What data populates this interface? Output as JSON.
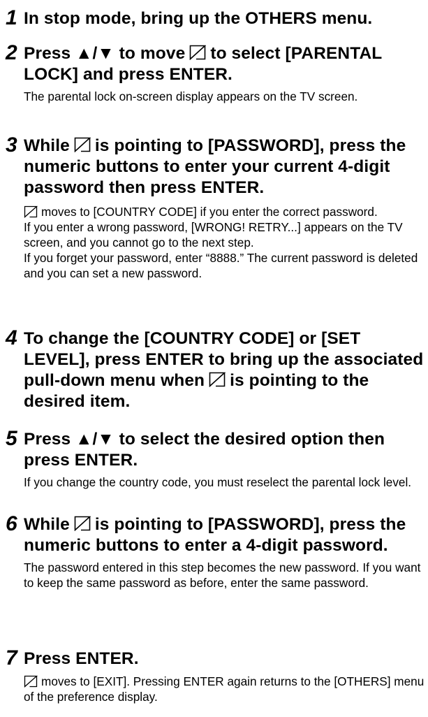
{
  "steps": [
    {
      "number": "1",
      "heading_parts": [
        "In stop mode, bring up the OTHERS menu."
      ],
      "body": []
    },
    {
      "number": "2",
      "heading_parts": [
        "Press ▲/▼ to move",
        "to select [PARENTAL LOCK] and press ENTER."
      ],
      "body": [
        "The parental lock on-screen display appears on the TV screen."
      ]
    },
    {
      "number": "3",
      "heading_parts": [
        "While",
        "is pointing to [PASSWORD], press the numeric buttons to enter your current 4-digit password then press ENTER."
      ],
      "body_cursor_line": "moves to [COUNTRY CODE] if you enter the correct password.",
      "body": [
        "If you enter a wrong password, [WRONG! RETRY...] appears on the TV screen, and you cannot go to the next step.",
        "If you forget your password, enter “8888.” The current password is deleted and you can set a new password."
      ]
    },
    {
      "number": "4",
      "heading_parts": [
        "To change the [COUNTRY CODE] or [SET LEVEL], press ENTER to bring up the associated pull-down menu when",
        "is pointing to the desired item."
      ],
      "body": []
    },
    {
      "number": "5",
      "heading_parts": [
        "Press ▲/▼ to select the desired option then press ENTER."
      ],
      "body": [
        "If you change the country code, you must reselect the parental lock level."
      ]
    },
    {
      "number": "6",
      "heading_parts": [
        "While",
        "is pointing to [PASSWORD], press the numeric buttons to enter a 4-digit password."
      ],
      "body": [
        "The password entered in this step becomes the new password. If you want to keep the same password as before, enter the same password."
      ]
    },
    {
      "number": "7",
      "heading_parts": [
        "Press ENTER."
      ],
      "body_cursor_line": "moves to [EXIT]. Pressing ENTER again returns to the [OTHERS] menu of the preference display.",
      "body": []
    }
  ],
  "icons": {
    "cursor": "cursor-icon"
  }
}
